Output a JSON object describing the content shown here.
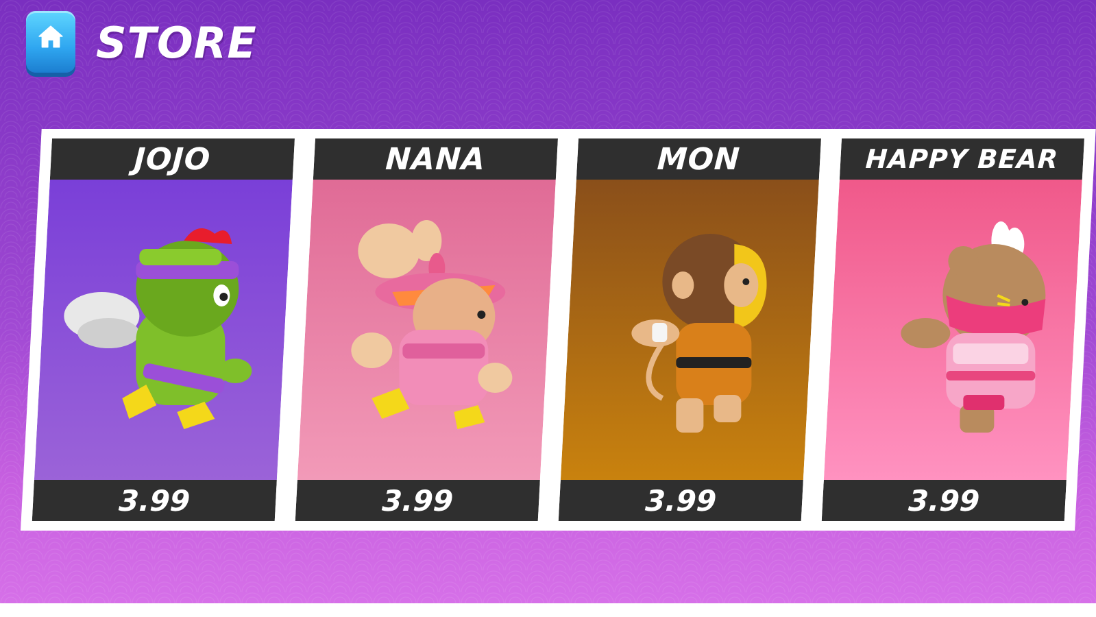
{
  "header": {
    "title": "STORE"
  },
  "icons": {
    "home": "home-icon"
  },
  "items": [
    {
      "name": "JOJO",
      "price": "3.99",
      "bg_top": "#7a3fd8",
      "bg_bottom": "#9b63d8",
      "character": "green-rooster-ninja"
    },
    {
      "name": "NANA",
      "price": "3.99",
      "bg_top": "#e06b96",
      "bg_bottom": "#f29ab8",
      "character": "pink-bunny-ninja"
    },
    {
      "name": "MON",
      "price": "3.99",
      "bg_top": "#8a4f1a",
      "bg_bottom": "#c9820e",
      "character": "orange-monkey-ninja"
    },
    {
      "name": "HAPPY BEAR",
      "price": "3.99",
      "bg_top": "#f0598a",
      "bg_bottom": "#ff92c0",
      "character": "pink-bear-ninja"
    }
  ]
}
